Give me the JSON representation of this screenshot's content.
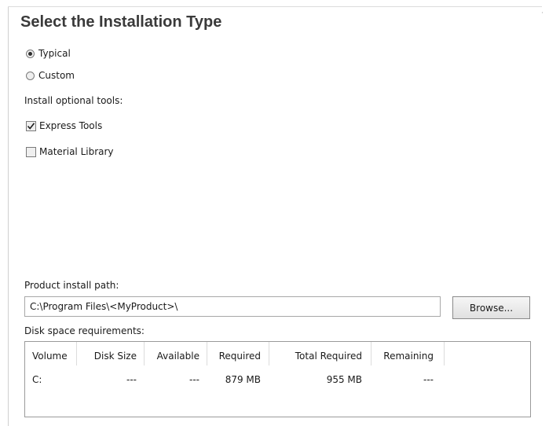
{
  "title": "Select the Installation Type",
  "install_type": {
    "options": [
      {
        "label": "Typical",
        "selected": true
      },
      {
        "label": "Custom",
        "selected": false
      }
    ]
  },
  "optional_tools": {
    "heading": "Install optional tools:",
    "items": [
      {
        "label": "Express Tools",
        "checked": true
      },
      {
        "label": "Material Library",
        "checked": false
      }
    ]
  },
  "install_path": {
    "label": "Product install path:",
    "value": "C:\\Program Files\\<MyProduct>\\",
    "browse_label": "Browse..."
  },
  "disk_space": {
    "label": "Disk space requirements:",
    "columns": [
      "Volume",
      "Disk Size",
      "Available",
      "Required",
      "Total Required",
      "Remaining"
    ],
    "rows": [
      [
        "C:",
        "---",
        "---",
        "879 MB",
        "955 MB",
        "---"
      ]
    ]
  }
}
